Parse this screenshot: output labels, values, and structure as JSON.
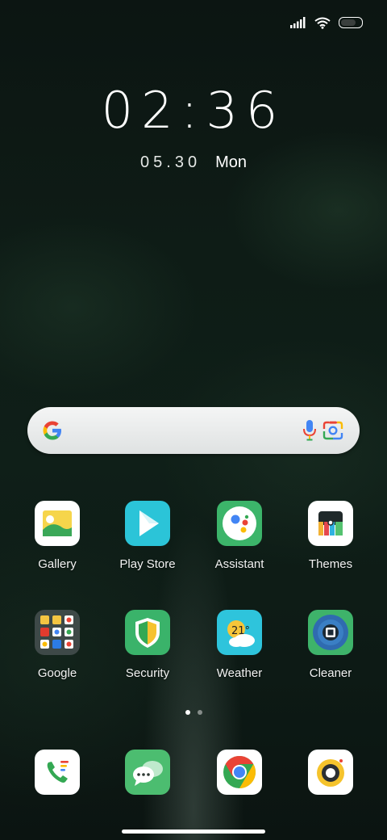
{
  "status": {
    "signal_icon": "signal-bars-icon",
    "wifi_icon": "wifi-icon",
    "battery_icon": "battery-icon",
    "battery_level": 0.88
  },
  "lock": {
    "time": "02:36",
    "date": "05.30",
    "day": "Mon"
  },
  "search": {
    "logo_icon": "google-g-icon",
    "mic_icon": "mic-icon",
    "lens_icon": "google-lens-icon"
  },
  "apps": [
    {
      "label": "Gallery",
      "icon": "gallery-icon"
    },
    {
      "label": "Play Store",
      "icon": "play-store-icon"
    },
    {
      "label": "Assistant",
      "icon": "assistant-icon"
    },
    {
      "label": "Themes",
      "icon": "themes-icon"
    },
    {
      "label": "Google",
      "icon": "google-folder-icon"
    },
    {
      "label": "Security",
      "icon": "security-shield-icon"
    },
    {
      "label": "Weather",
      "icon": "weather-icon",
      "temp": "21°"
    },
    {
      "label": "Cleaner",
      "icon": "cleaner-icon"
    }
  ],
  "dock": [
    {
      "icon": "phone-icon"
    },
    {
      "icon": "messages-icon"
    },
    {
      "icon": "chrome-icon"
    },
    {
      "icon": "camera-icon"
    }
  ],
  "pager": {
    "pages": 2,
    "current": 1
  },
  "colors": {
    "accent_blue": "#4285F4",
    "accent_red": "#EA4335",
    "accent_yellow": "#FBBC05",
    "accent_green": "#34A853"
  }
}
